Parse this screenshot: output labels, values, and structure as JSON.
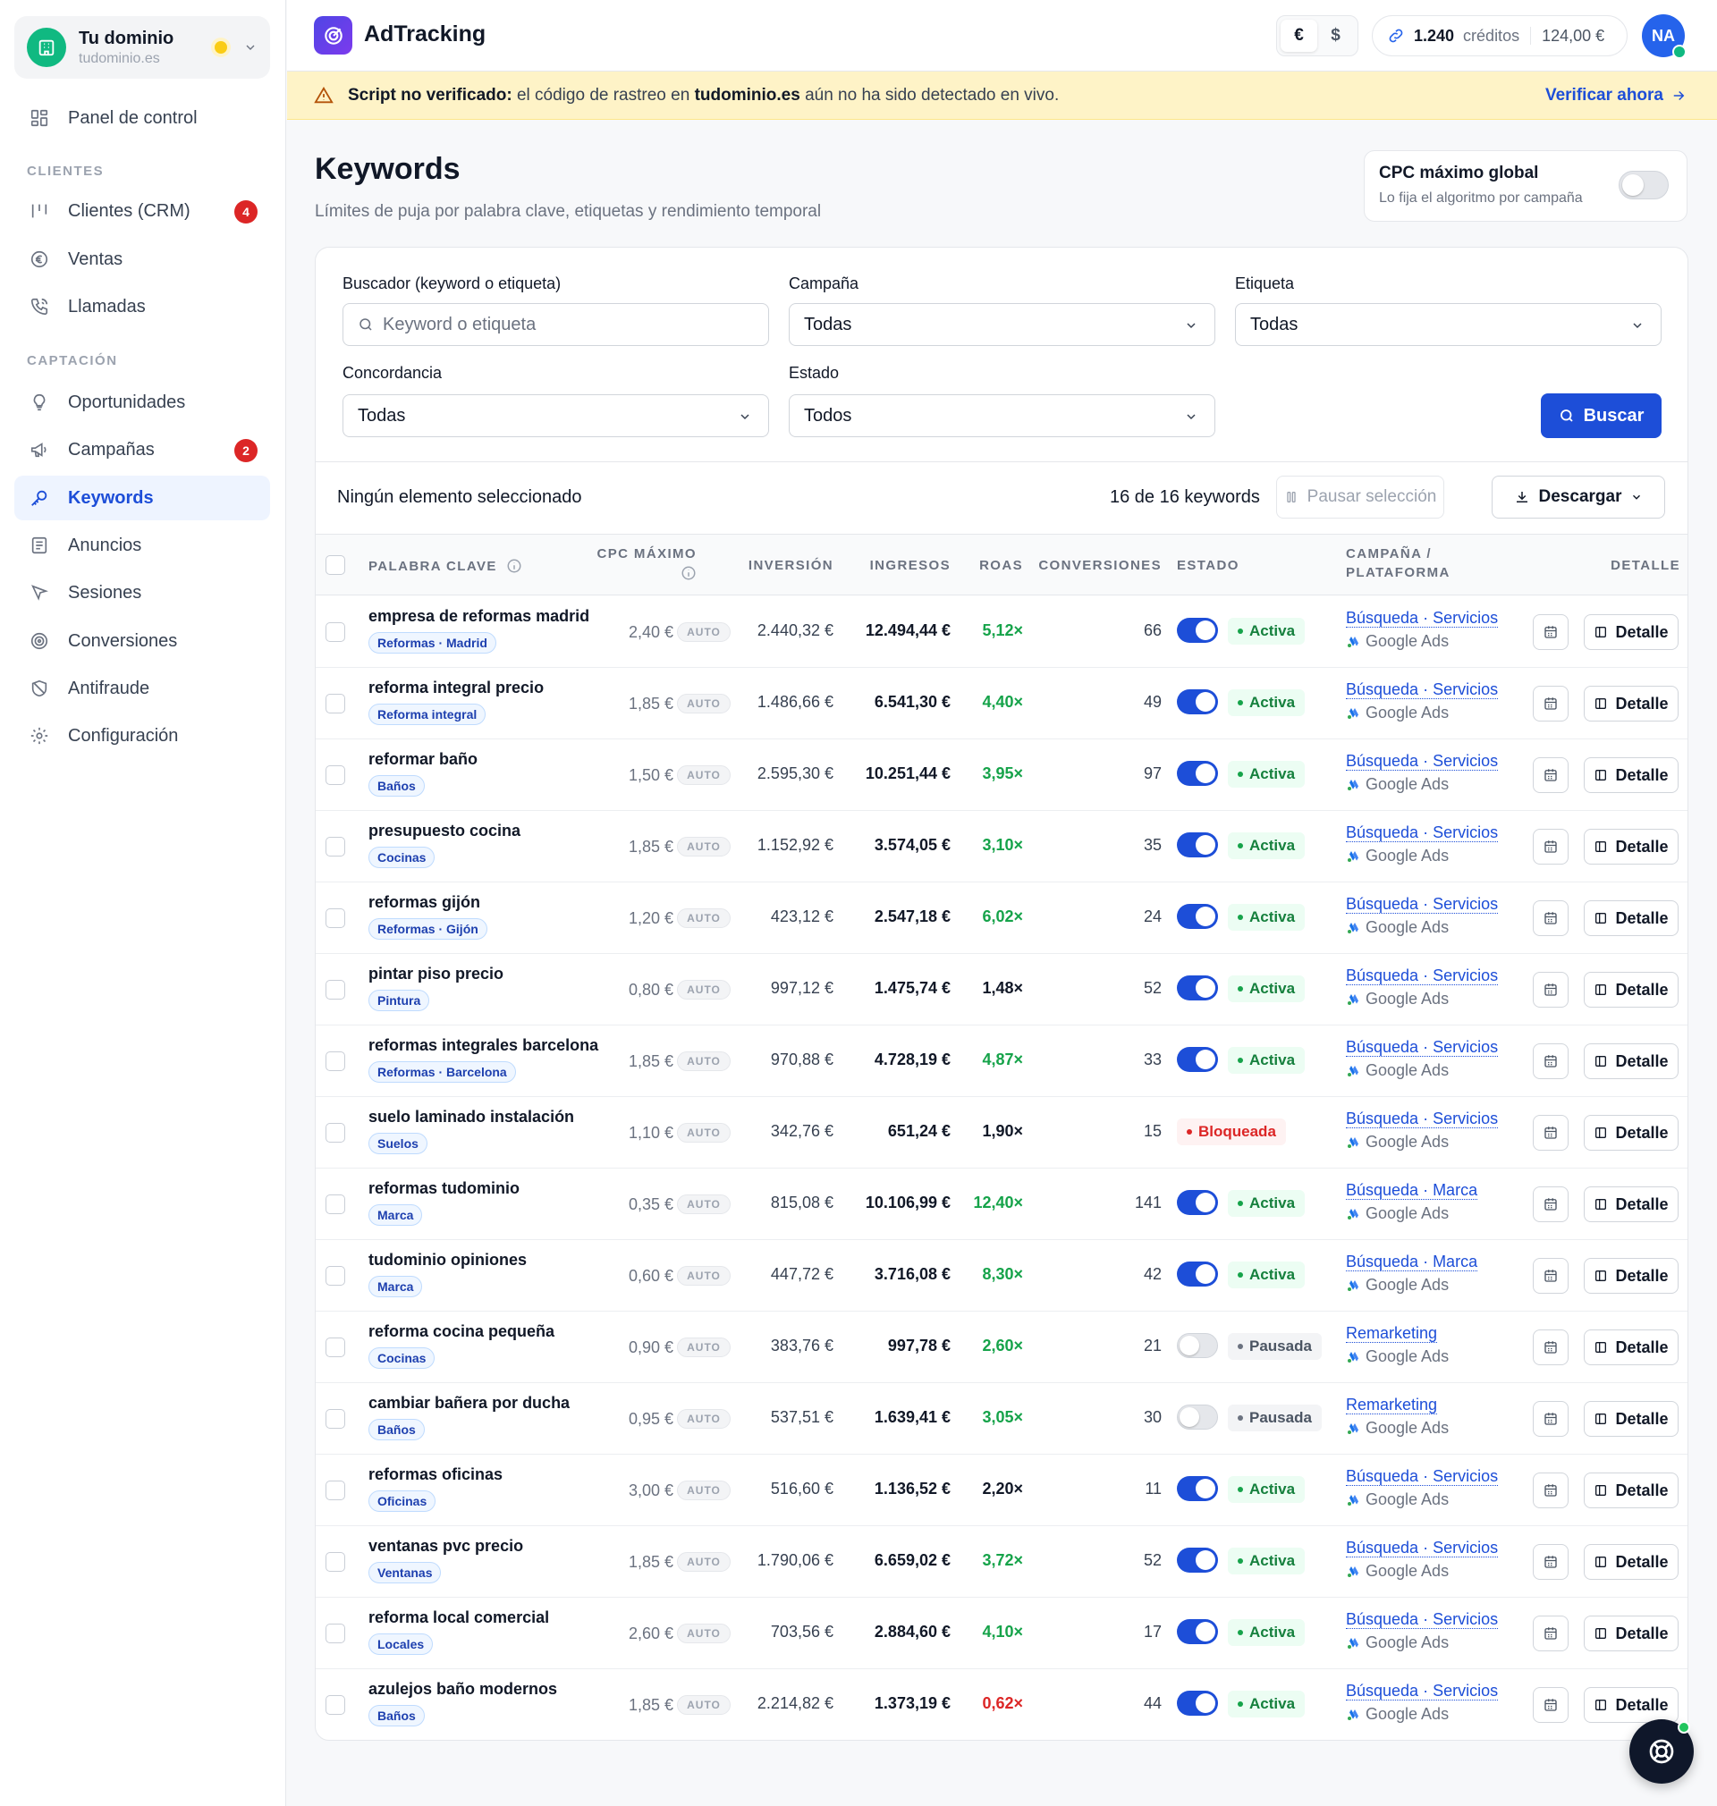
{
  "workspace": {
    "name": "Tu dominio",
    "domain": "tudominio.es"
  },
  "nav": {
    "panel": "Panel de control",
    "section_clientes": "CLIENTES",
    "clientes": "Clientes (CRM)",
    "clientes_badge": "4",
    "ventas": "Ventas",
    "llamadas": "Llamadas",
    "section_captacion": "CAPTACIÓN",
    "oportunidades": "Oportunidades",
    "campanas": "Campañas",
    "campanas_badge": "2",
    "keywords": "Keywords",
    "anuncios": "Anuncios",
    "sesiones": "Sesiones",
    "conversiones": "Conversiones",
    "antifraude": "Antifraude",
    "configuracion": "Configuración"
  },
  "topbar": {
    "brand": "AdTracking",
    "currency_eur": "€",
    "currency_usd": "$",
    "credits_value": "1.240",
    "credits_label": "créditos",
    "credits_amount": "124,00 €",
    "avatar": "NA"
  },
  "banner": {
    "strong": "Script no verificado:",
    "text1": " el código de rastreo en ",
    "domain": "tudominio.es",
    "text2": " aún no ha sido detectado en vivo.",
    "action": "Verificar ahora"
  },
  "page": {
    "title": "Keywords",
    "subtitle": "Límites de puja por palabra clave, etiquetas y rendimiento temporal"
  },
  "cpc_global": {
    "title": "CPC máximo global",
    "subtitle": "Lo fija el algoritmo por campaña",
    "enabled": false
  },
  "filters": {
    "search_label": "Buscador (keyword o etiqueta)",
    "search_placeholder": "Keyword o etiqueta",
    "campaign_label": "Campaña",
    "campaign_value": "Todas",
    "tag_label": "Etiqueta",
    "tag_value": "Todas",
    "match_label": "Concordancia",
    "match_value": "Todas",
    "status_label": "Estado",
    "status_value": "Todos",
    "search_button": "Buscar"
  },
  "toolbar": {
    "selection": "Ningún elemento seleccionado",
    "count": "16 de 16 keywords",
    "pause": "Pausar selección",
    "download": "Descargar"
  },
  "columns": {
    "keyword": "PALABRA CLAVE",
    "cpc_line1": "CPC MÁXIMO",
    "investment": "INVERSIÓN",
    "revenue": "INGRESOS",
    "roas": "ROAS",
    "conversions": "CONVERSIONES",
    "status": "ESTADO",
    "campaign_line1": "CAMPAÑA /",
    "campaign_line2": "PLATAFORMA",
    "detail": "DETALLE"
  },
  "labels": {
    "auto": "AUTO",
    "detail_button": "Detalle",
    "platform": "Google Ads"
  },
  "colors": {
    "primary": "#1d4ed8",
    "positive": "#16a34a",
    "negative": "#dc2626"
  },
  "rows": [
    {
      "kw": "empresa de reformas madrid",
      "tag": "Reformas · Madrid",
      "cpc": "2,40 €",
      "inv": "2.440,32 €",
      "ing": "12.494,44 €",
      "roas": "5,12×",
      "roas_color": "green",
      "conv": "66",
      "status": "Activa",
      "campaign": "Búsqueda · Servicios"
    },
    {
      "kw": "reforma integral precio",
      "tag": "Reforma integral",
      "cpc": "1,85 €",
      "inv": "1.486,66 €",
      "ing": "6.541,30 €",
      "roas": "4,40×",
      "roas_color": "green",
      "conv": "49",
      "status": "Activa",
      "campaign": "Búsqueda · Servicios"
    },
    {
      "kw": "reformar baño",
      "tag": "Baños",
      "cpc": "1,50 €",
      "inv": "2.595,30 €",
      "ing": "10.251,44 €",
      "roas": "3,95×",
      "roas_color": "green",
      "conv": "97",
      "status": "Activa",
      "campaign": "Búsqueda · Servicios"
    },
    {
      "kw": "presupuesto cocina",
      "tag": "Cocinas",
      "cpc": "1,85 €",
      "inv": "1.152,92 €",
      "ing": "3.574,05 €",
      "roas": "3,10×",
      "roas_color": "green",
      "conv": "35",
      "status": "Activa",
      "campaign": "Búsqueda · Servicios"
    },
    {
      "kw": "reformas gijón",
      "tag": "Reformas · Gijón",
      "cpc": "1,20 €",
      "inv": "423,12 €",
      "ing": "2.547,18 €",
      "roas": "6,02×",
      "roas_color": "green",
      "conv": "24",
      "status": "Activa",
      "campaign": "Búsqueda · Servicios"
    },
    {
      "kw": "pintar piso precio",
      "tag": "Pintura",
      "cpc": "0,80 €",
      "inv": "997,12 €",
      "ing": "1.475,74 €",
      "roas": "1,48×",
      "roas_color": "dark",
      "conv": "52",
      "status": "Activa",
      "campaign": "Búsqueda · Servicios"
    },
    {
      "kw": "reformas integrales barcelona",
      "tag": "Reformas · Barcelona",
      "cpc": "1,85 €",
      "inv": "970,88 €",
      "ing": "4.728,19 €",
      "roas": "4,87×",
      "roas_color": "green",
      "conv": "33",
      "status": "Activa",
      "campaign": "Búsqueda · Servicios"
    },
    {
      "kw": "suelo laminado instalación",
      "tag": "Suelos",
      "cpc": "1,10 €",
      "inv": "342,76 €",
      "ing": "651,24 €",
      "roas": "1,90×",
      "roas_color": "dark",
      "conv": "15",
      "status": "Bloqueada",
      "campaign": "Búsqueda · Servicios"
    },
    {
      "kw": "reformas tudominio",
      "tag": "Marca",
      "cpc": "0,35 €",
      "inv": "815,08 €",
      "ing": "10.106,99 €",
      "roas": "12,40×",
      "roas_color": "green",
      "conv": "141",
      "status": "Activa",
      "campaign": "Búsqueda · Marca"
    },
    {
      "kw": "tudominio opiniones",
      "tag": "Marca",
      "cpc": "0,60 €",
      "inv": "447,72 €",
      "ing": "3.716,08 €",
      "roas": "8,30×",
      "roas_color": "green",
      "conv": "42",
      "status": "Activa",
      "campaign": "Búsqueda · Marca"
    },
    {
      "kw": "reforma cocina pequeña",
      "tag": "Cocinas",
      "cpc": "0,90 €",
      "inv": "383,76 €",
      "ing": "997,78 €",
      "roas": "2,60×",
      "roas_color": "green",
      "conv": "21",
      "status": "Pausada",
      "campaign": "Remarketing"
    },
    {
      "kw": "cambiar bañera por ducha",
      "tag": "Baños",
      "cpc": "0,95 €",
      "inv": "537,51 €",
      "ing": "1.639,41 €",
      "roas": "3,05×",
      "roas_color": "green",
      "conv": "30",
      "status": "Pausada",
      "campaign": "Remarketing"
    },
    {
      "kw": "reformas oficinas",
      "tag": "Oficinas",
      "cpc": "3,00 €",
      "inv": "516,60 €",
      "ing": "1.136,52 €",
      "roas": "2,20×",
      "roas_color": "dark",
      "conv": "11",
      "status": "Activa",
      "campaign": "Búsqueda · Servicios"
    },
    {
      "kw": "ventanas pvc precio",
      "tag": "Ventanas",
      "cpc": "1,85 €",
      "inv": "1.790,06 €",
      "ing": "6.659,02 €",
      "roas": "3,72×",
      "roas_color": "green",
      "conv": "52",
      "status": "Activa",
      "campaign": "Búsqueda · Servicios"
    },
    {
      "kw": "reforma local comercial",
      "tag": "Locales",
      "cpc": "2,60 €",
      "inv": "703,56 €",
      "ing": "2.884,60 €",
      "roas": "4,10×",
      "roas_color": "green",
      "conv": "17",
      "status": "Activa",
      "campaign": "Búsqueda · Servicios"
    },
    {
      "kw": "azulejos baño modernos",
      "tag": "Baños",
      "cpc": "1,85 €",
      "inv": "2.214,82 €",
      "ing": "1.373,19 €",
      "roas": "0,62×",
      "roas_color": "red",
      "conv": "44",
      "status": "Activa",
      "campaign": "Búsqueda · Servicios"
    }
  ]
}
